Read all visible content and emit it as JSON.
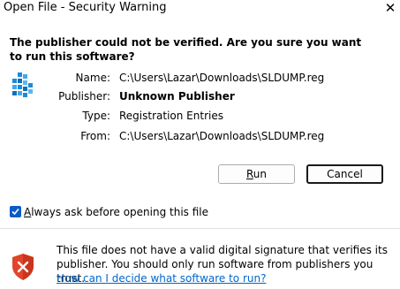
{
  "window": {
    "title": "Open File - Security Warning",
    "close_glyph": "✕"
  },
  "question": "The publisher could not be verified.  Are you sure you want to run this software?",
  "details": [
    {
      "label": "Name:",
      "value": "C:\\Users\\Lazar\\Downloads\\SLDUMP.reg",
      "bold": false
    },
    {
      "label": "Publisher:",
      "value": "Unknown Publisher",
      "bold": true
    },
    {
      "label": "Type:",
      "value": "Registration Entries",
      "bold": false
    },
    {
      "label": "From:",
      "value": "C:\\Users\\Lazar\\Downloads\\SLDUMP.reg",
      "bold": false
    }
  ],
  "buttons": {
    "run": "Run",
    "cancel": "Cancel"
  },
  "checkbox": {
    "label": "Always ask before opening this file",
    "checked": true
  },
  "footer": {
    "text": "This file does not have a valid digital signature that verifies its publisher.  You should only run software from publishers you trust.",
    "link": "How can I decide what software to run?"
  },
  "colors": {
    "accent": "#0a5ac8",
    "link": "#0066cc",
    "shield_red": "#e0452a"
  },
  "icons": {
    "file": "registry-file-icon",
    "shield": "security-shield-icon",
    "close": "close-icon"
  }
}
